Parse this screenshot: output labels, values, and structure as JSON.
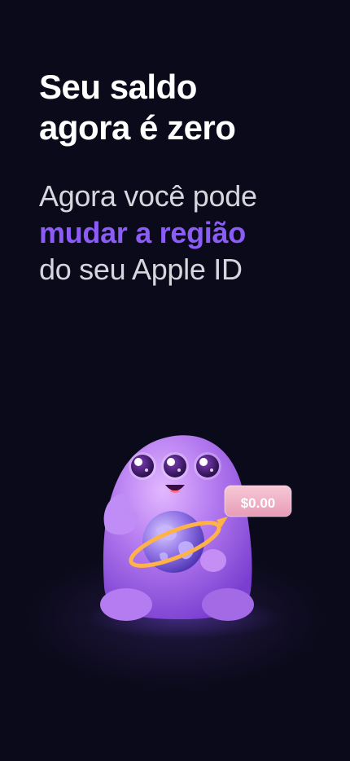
{
  "headline": {
    "line1": "Seu saldo",
    "line2": "agora é zero"
  },
  "subtitle": {
    "line1": "Agora você pode",
    "line2_highlight": "mudar a região",
    "line3": "do seu Apple ID"
  },
  "illustration": {
    "price_tag": "$0.00",
    "icon_name": "mascot-holding-globe",
    "colors": {
      "background": "#0b0a1a",
      "accent": "#8b5cf6",
      "mascot": "#b57bf0",
      "tag_bg": "#f1b6c8"
    }
  }
}
